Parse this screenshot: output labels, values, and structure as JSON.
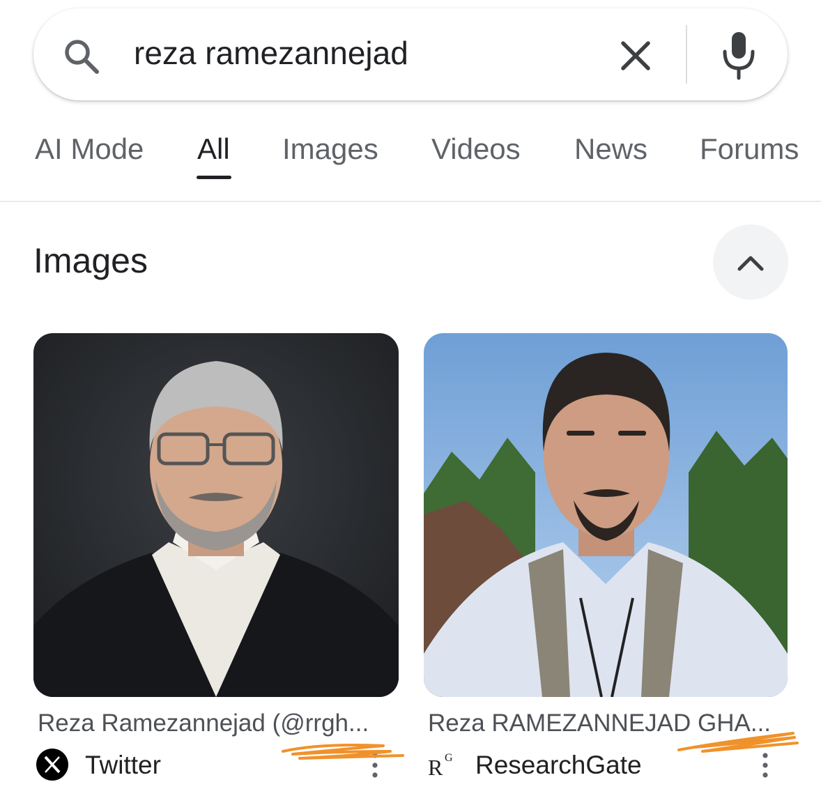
{
  "search": {
    "query": "reza ramezannejad"
  },
  "tabs": [
    {
      "label": "AI Mode"
    },
    {
      "label": "All",
      "active": true
    },
    {
      "label": "Images"
    },
    {
      "label": "Videos"
    },
    {
      "label": "News"
    },
    {
      "label": "Forums"
    }
  ],
  "images_section": {
    "title": "Images",
    "results": [
      {
        "title": "Reza Ramezannejad (@rrgh...",
        "source": "Twitter",
        "source_icon": "x-logo-icon"
      },
      {
        "title": "Reza RAMEZANNEJAD GHA...",
        "source": "ResearchGate",
        "source_icon": "researchgate-logo-icon",
        "source_icon_text": "R",
        "source_icon_superscript": "G"
      }
    ]
  },
  "colors": {
    "text_primary": "#202124",
    "text_secondary": "#5f6368",
    "annotation_orange": "#f0922b"
  }
}
